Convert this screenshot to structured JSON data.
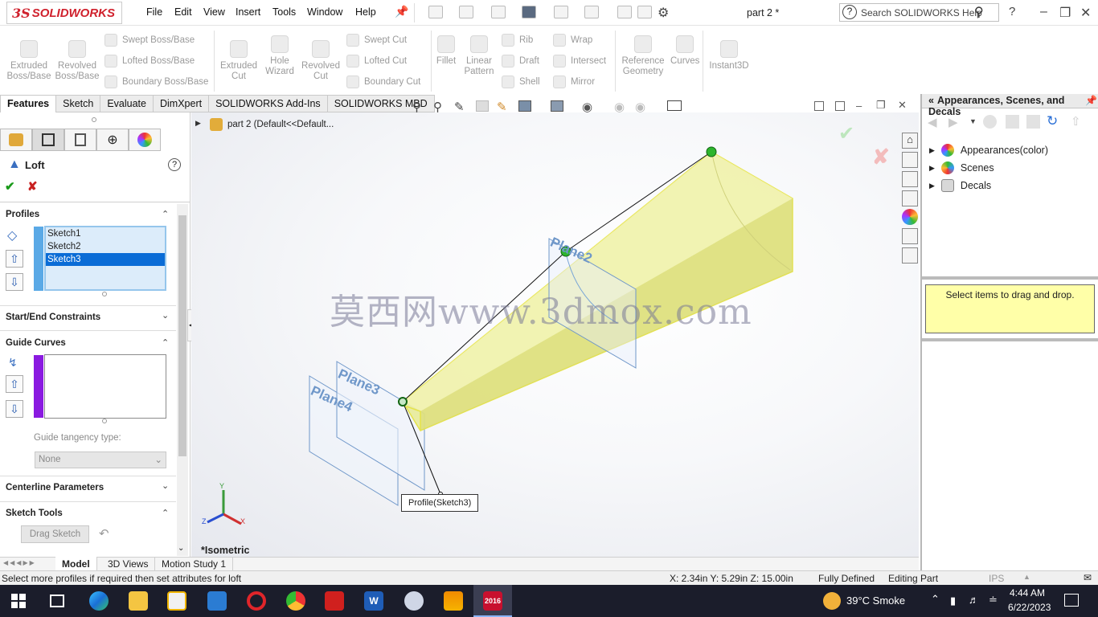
{
  "app": {
    "logo_text": "SOLIDWORKS",
    "logo_mark": "3S",
    "document_title": "part 2 *"
  },
  "menu": [
    "File",
    "Edit",
    "View",
    "Insert",
    "Tools",
    "Window",
    "Help"
  ],
  "help_search": {
    "placeholder": "Search SOLIDWORKS Help"
  },
  "ribbon": {
    "extruded_boss": "Extruded Boss/Base",
    "revolved_boss": "Revolved Boss/Base",
    "swept_boss": "Swept Boss/Base",
    "lofted_boss": "Lofted Boss/Base",
    "boundary_boss": "Boundary Boss/Base",
    "extruded_cut": "Extruded Cut",
    "hole_wizard": "Hole Wizard",
    "revolved_cut": "Revolved Cut",
    "swept_cut": "Swept Cut",
    "lofted_cut": "Lofted Cut",
    "boundary_cut": "Boundary Cut",
    "fillet": "Fillet",
    "linear_pattern": "Linear Pattern",
    "rib": "Rib",
    "draft": "Draft",
    "shell": "Shell",
    "wrap": "Wrap",
    "intersect": "Intersect",
    "mirror": "Mirror",
    "reference_geometry": "Reference Geometry",
    "curves": "Curves",
    "instant3d": "Instant3D"
  },
  "command_tabs": [
    "Features",
    "Sketch",
    "Evaluate",
    "DimXpert",
    "SOLIDWORKS Add-Ins",
    "SOLIDWORKS MBD"
  ],
  "property_manager": {
    "title": "Loft",
    "profiles_section": "Profiles",
    "profiles": [
      "Sketch1",
      "Sketch2",
      "Sketch3"
    ],
    "start_end_section": "Start/End Constraints",
    "guide_curves_section": "Guide Curves",
    "guide_tangency_label": "Guide tangency type:",
    "guide_tangency_value": "None",
    "centerline_section": "Centerline Parameters",
    "sketch_tools_section": "Sketch Tools",
    "drag_sketch": "Drag Sketch"
  },
  "viewport": {
    "tree_root": "part 2  (Default<<Default...",
    "view_label": "*Isometric",
    "plane_labels": [
      "Plane2",
      "Plane3",
      "Plane4"
    ],
    "callout": "Profile(Sketch3)",
    "watermark": "莫西网www.3dmox.com"
  },
  "bottom_tabs": [
    "Model",
    "3D Views",
    "Motion Study 1"
  ],
  "task_pane": {
    "title": "Appearances, Scenes, and Decals",
    "items": [
      "Appearances(color)",
      "Scenes",
      "Decals"
    ],
    "drop_hint": "Select items to drag and drop."
  },
  "status_bar": {
    "message": "Select more profiles if required then set attributes for loft",
    "coords": "X: 2.34in Y: 5.29in Z: 15.00in",
    "state": "Fully Defined",
    "mode": "Editing Part",
    "units": "IPS"
  },
  "taskbar": {
    "weather": "39°C  Smoke",
    "time": "4:44 AM",
    "date": "6/22/2023",
    "sw_badge": "2016"
  },
  "colors": {
    "selection_blue": "#0a6cd6",
    "loft_yellow": "#f3f3a0",
    "plane_blue": "#6f97c9",
    "accent_red": "#d0212d",
    "taskbar": "#1b1d2b"
  }
}
